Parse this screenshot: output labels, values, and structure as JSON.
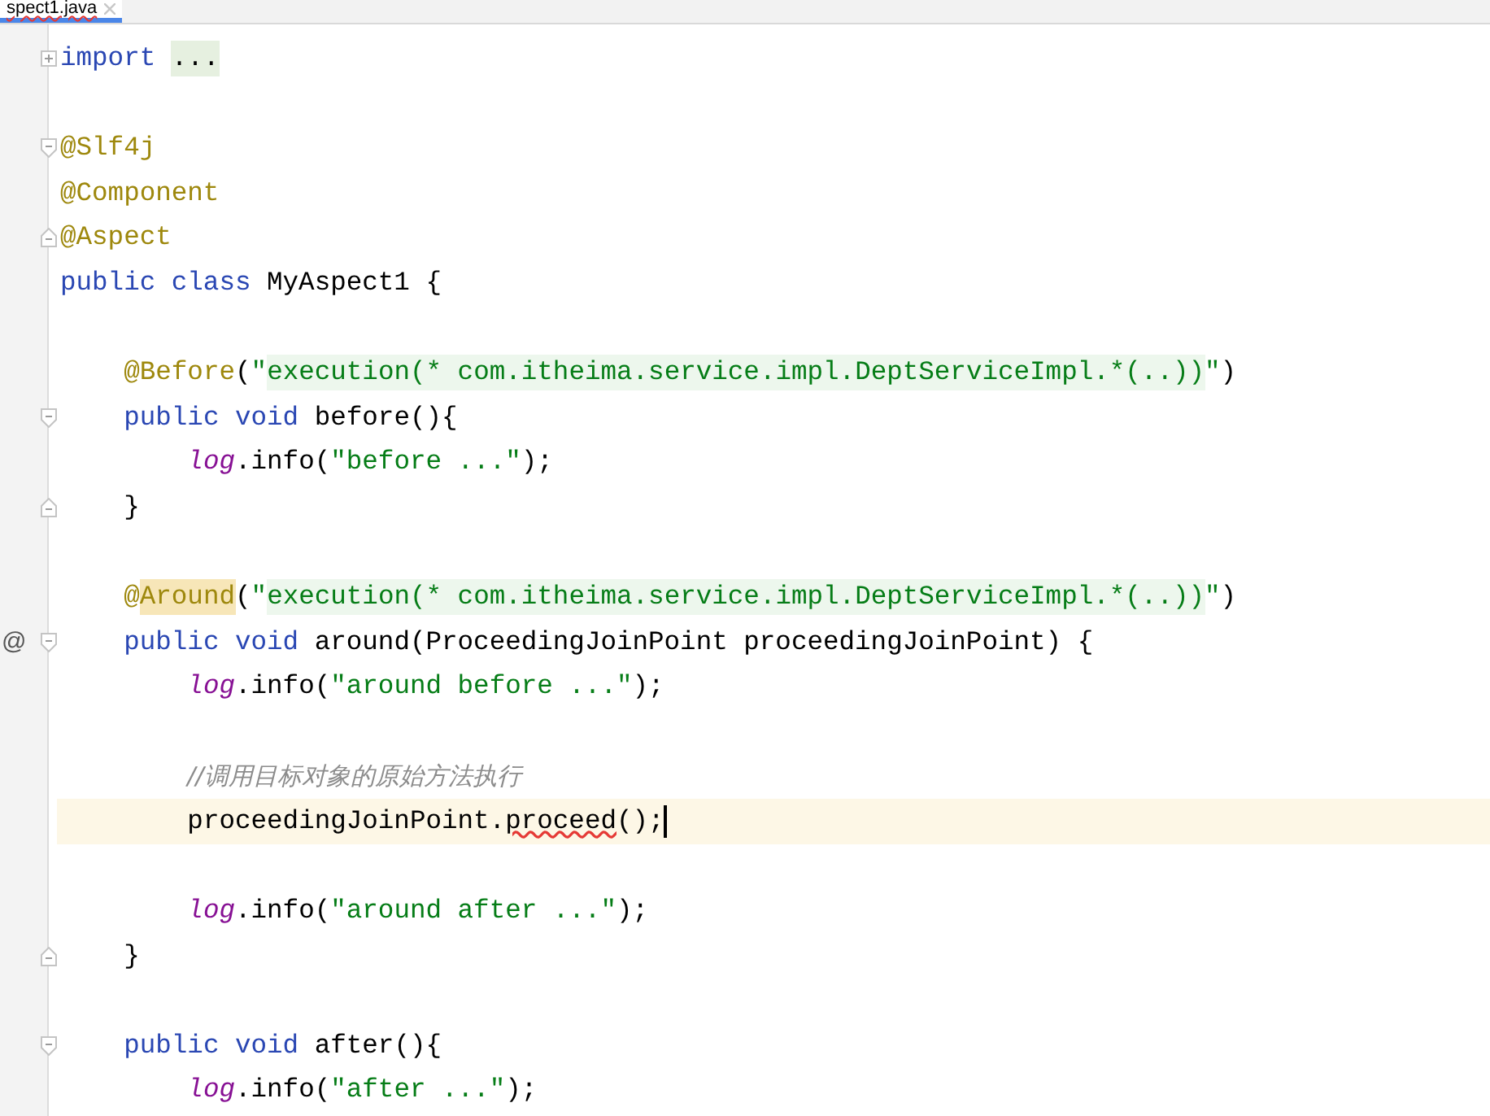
{
  "tab": {
    "title": "spect1.java",
    "selected": true
  },
  "blocks": [
    {
      "lines": [
        {
          "gutter": {
            "kind": "collapsed"
          },
          "tokens": [
            {
              "kind": "kw",
              "text": "import "
            },
            {
              "kind": "folded",
              "text": "..."
            }
          ]
        }
      ]
    },
    {
      "lines": [
        {
          "gutter": {
            "kind": "fold-start"
          },
          "tokens": [
            {
              "kind": "ann",
              "text": "@Slf4j"
            }
          ]
        },
        {
          "tokens": [
            {
              "kind": "ann",
              "text": "@Component"
            }
          ]
        },
        {
          "gutter": {
            "kind": "fold-end"
          },
          "tokens": [
            {
              "kind": "ann",
              "text": "@Aspect"
            }
          ]
        },
        {
          "tokens": [
            {
              "kind": "kw",
              "text": "public class "
            },
            {
              "kind": "plain",
              "text": "MyAspect1 {"
            }
          ]
        }
      ]
    },
    {
      "lines": [
        {
          "tokens": [
            {
              "kind": "ann",
              "text": "    @Before"
            },
            {
              "kind": "plain",
              "text": "("
            },
            {
              "kind": "str",
              "text": "\""
            },
            {
              "kind": "inj",
              "text": "execution(* com.itheima.service.impl.DeptServiceImpl.*(..))"
            },
            {
              "kind": "str",
              "text": "\""
            },
            {
              "kind": "plain",
              "text": ")"
            }
          ]
        },
        {
          "gutter": {
            "kind": "fold-start"
          },
          "tokens": [
            {
              "kind": "kw",
              "text": "    public void "
            },
            {
              "kind": "plain",
              "text": "before(){"
            }
          ]
        },
        {
          "tokens": [
            {
              "kind": "field",
              "text": "        log"
            },
            {
              "kind": "plain",
              "text": ".info("
            },
            {
              "kind": "str",
              "text": "\"before ...\""
            },
            {
              "kind": "plain",
              "text": ");"
            }
          ]
        },
        {
          "gutter": {
            "kind": "fold-end"
          },
          "tokens": [
            {
              "kind": "plain",
              "text": "    }"
            }
          ]
        }
      ]
    },
    {
      "lines": [
        {
          "tokens": [
            {
              "kind": "ann",
              "text": "    @"
            },
            {
              "kind": "annhl",
              "text": "Around"
            },
            {
              "kind": "plain",
              "text": "("
            },
            {
              "kind": "str",
              "text": "\""
            },
            {
              "kind": "inj",
              "text": "execution(* com.itheima.service.impl.DeptServiceImpl.*(..))"
            },
            {
              "kind": "str",
              "text": "\""
            },
            {
              "kind": "plain",
              "text": ")"
            }
          ]
        },
        {
          "gutter": {
            "kind": "fold-start",
            "mark": "@"
          },
          "tokens": [
            {
              "kind": "kw",
              "text": "    public void "
            },
            {
              "kind": "plain",
              "text": "around(ProceedingJoinPoint proceedingJoinPoint) {"
            }
          ]
        },
        {
          "tokens": [
            {
              "kind": "field",
              "text": "        log"
            },
            {
              "kind": "plain",
              "text": ".info("
            },
            {
              "kind": "str",
              "text": "\"around before ...\""
            },
            {
              "kind": "plain",
              "text": ");"
            }
          ]
        }
      ]
    },
    {
      "lines": [
        {
          "tokens": [
            {
              "kind": "comment",
              "text": "        //调用目标对象的原始方法执行"
            }
          ]
        },
        {
          "current": true,
          "caret": true,
          "tokens": [
            {
              "kind": "plain",
              "text": "        proceedingJoinPoint."
            },
            {
              "kind": "warn",
              "text": "proceed"
            },
            {
              "kind": "plain",
              "text": "();"
            }
          ]
        }
      ]
    },
    {
      "lines": [
        {
          "tokens": [
            {
              "kind": "field",
              "text": "        log"
            },
            {
              "kind": "plain",
              "text": ".info("
            },
            {
              "kind": "str",
              "text": "\"around after ...\""
            },
            {
              "kind": "plain",
              "text": ");"
            }
          ]
        },
        {
          "gutter": {
            "kind": "fold-end"
          },
          "tokens": [
            {
              "kind": "plain",
              "text": "    }"
            }
          ]
        }
      ]
    },
    {
      "lines": [
        {
          "gutter": {
            "kind": "fold-start"
          },
          "tokens": [
            {
              "kind": "kw",
              "text": "    public void "
            },
            {
              "kind": "plain",
              "text": "after(){"
            }
          ]
        },
        {
          "tokens": [
            {
              "kind": "field",
              "text": "        log"
            },
            {
              "kind": "plain",
              "text": ".info("
            },
            {
              "kind": "str",
              "text": "\"after ...\""
            },
            {
              "kind": "plain",
              "text": ");"
            }
          ]
        }
      ]
    }
  ]
}
